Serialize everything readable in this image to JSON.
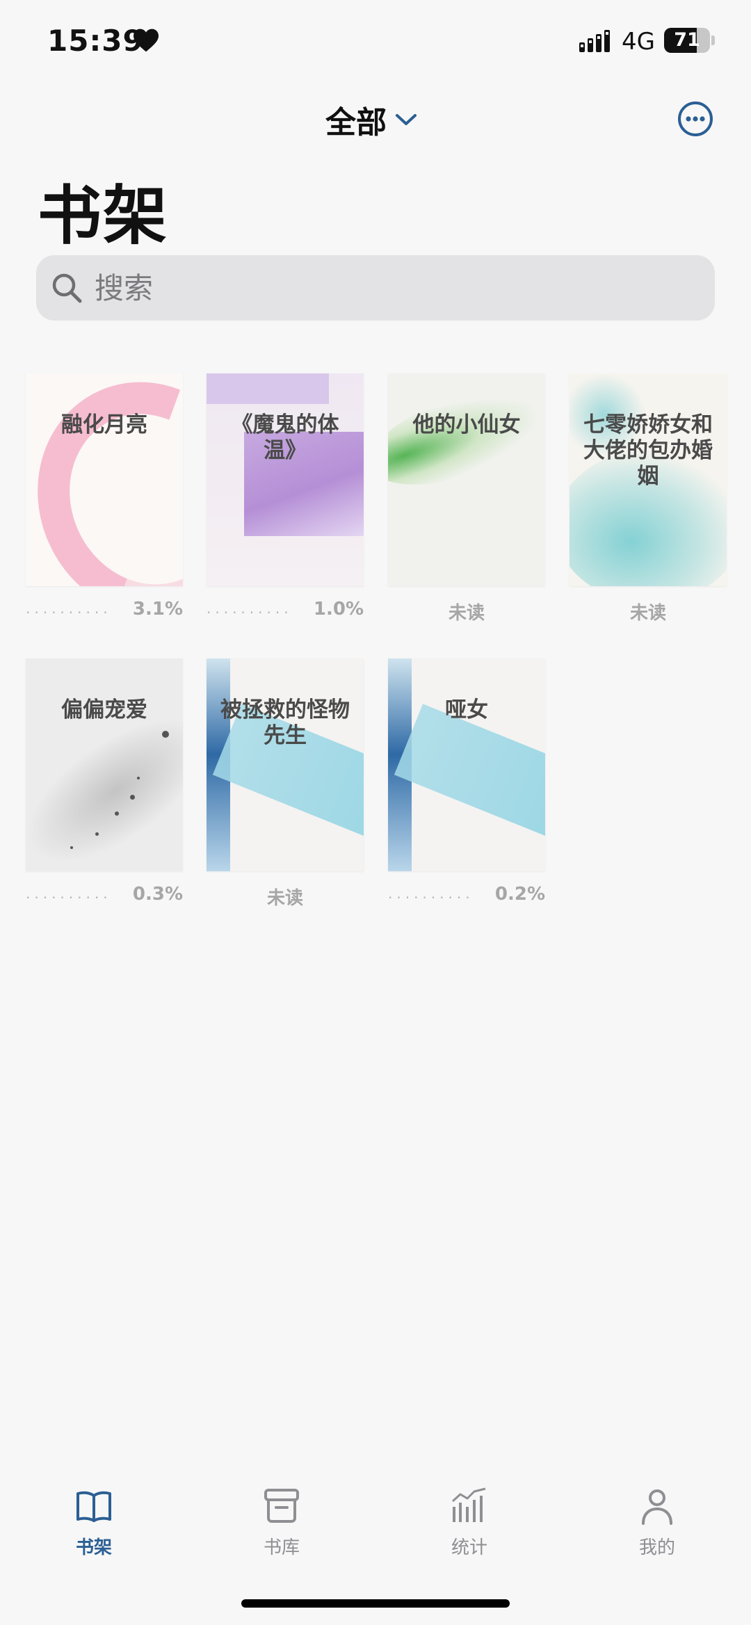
{
  "status": {
    "time": "15:39",
    "network": "4G",
    "battery": "71",
    "battery_level": 0.71
  },
  "nav": {
    "filter_label": "全部"
  },
  "page_title": "书架",
  "search": {
    "placeholder": "搜索"
  },
  "books": [
    {
      "title": "融化月亮",
      "progress_text": "3.1%",
      "status": "progress"
    },
    {
      "title": "《魔鬼的体温》",
      "progress_text": "1.0%",
      "status": "progress"
    },
    {
      "title": "他的小仙女",
      "progress_text": "未读",
      "status": "unread"
    },
    {
      "title": "七零娇娇女和大佬的包办婚姻",
      "progress_text": "未读",
      "status": "unread"
    },
    {
      "title": "偏偏宠爱",
      "progress_text": "0.3%",
      "status": "progress"
    },
    {
      "title": "被拯救的怪物先生",
      "progress_text": "未读",
      "status": "unread"
    },
    {
      "title": "哑女",
      "progress_text": "0.2%",
      "status": "progress"
    }
  ],
  "progress_dots": "··········",
  "tabs": [
    {
      "label": "书架",
      "icon": "book-open-icon",
      "active": true
    },
    {
      "label": "书库",
      "icon": "archive-box-icon",
      "active": false
    },
    {
      "label": "统计",
      "icon": "bar-chart-icon",
      "active": false
    },
    {
      "label": "我的",
      "icon": "person-icon",
      "active": false
    }
  ],
  "colors": {
    "accent": "#2b5f94",
    "background": "#f7f7f7",
    "search_bg": "#e3e3e5",
    "muted_text": "#a6a6a6"
  }
}
